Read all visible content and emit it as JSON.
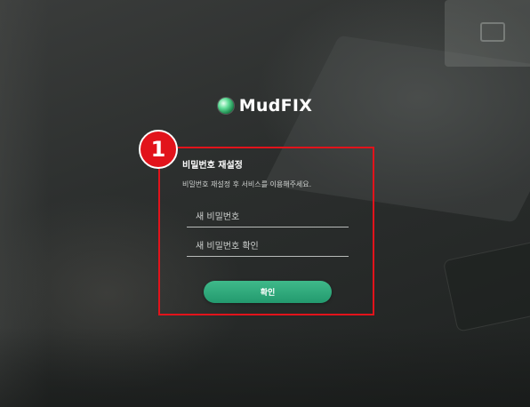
{
  "brand": {
    "name": "MudFIX",
    "logo_icon": "green-sphere-icon",
    "accent_color": "#2aa776"
  },
  "annotation": {
    "step_number": "1",
    "highlight_color": "#e2131b"
  },
  "form": {
    "title": "비밀번호 재설정",
    "description": "비밀번호 재설정 후 서비스를 이용해주세요.",
    "new_password_placeholder": "새 비밀번호",
    "confirm_password_placeholder": "새 비밀번호 확인",
    "submit_label": "확인"
  }
}
